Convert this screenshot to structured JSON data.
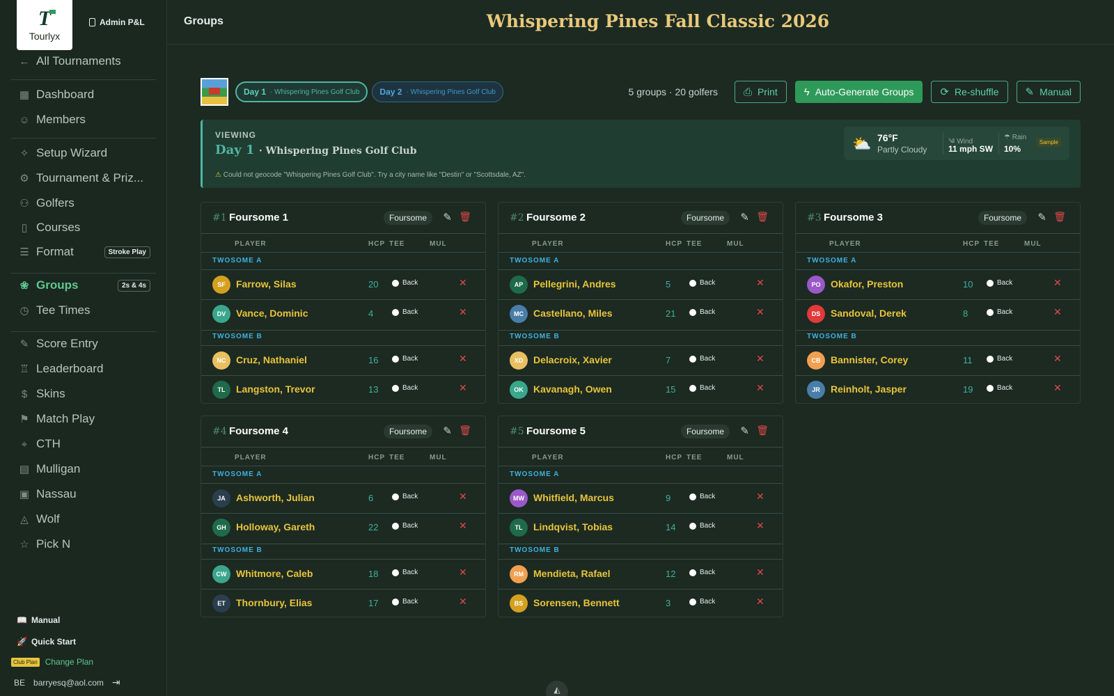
{
  "brand": {
    "logo_text": "Tourlyx",
    "admin_label": "Admin P&L"
  },
  "sidebar": {
    "back": "All Tournaments",
    "items": [
      {
        "label": "Dashboard",
        "icon": "grid-icon"
      },
      {
        "label": "Members",
        "icon": "user-icon"
      },
      {
        "label": "Setup Wizard",
        "icon": "sparkle-icon"
      },
      {
        "label": "Tournament & Priz...",
        "icon": "gear-icon"
      },
      {
        "label": "Golfers",
        "icon": "users-icon"
      },
      {
        "label": "Courses",
        "icon": "map-icon"
      },
      {
        "label": "Format",
        "icon": "sliders-icon",
        "badge": "Stroke Play"
      },
      {
        "label": "Groups",
        "icon": "group-icon",
        "badge": "2s & 4s",
        "active": true
      },
      {
        "label": "Tee Times",
        "icon": "clock-icon"
      },
      {
        "label": "Score Entry",
        "icon": "pencil-icon"
      },
      {
        "label": "Leaderboard",
        "icon": "trophy-icon"
      },
      {
        "label": "Skins",
        "icon": "dollar-icon"
      },
      {
        "label": "Match Play",
        "icon": "flag-icon"
      },
      {
        "label": "CTH",
        "icon": "pin-icon"
      },
      {
        "label": "Mulligan",
        "icon": "ticket-icon"
      },
      {
        "label": "Nassau",
        "icon": "money-icon"
      },
      {
        "label": "Wolf",
        "icon": "wolf-icon"
      },
      {
        "label": "Pick N",
        "icon": "star-icon"
      }
    ],
    "manual": "Manual",
    "quick_start": "Quick Start",
    "plan_badge": "Club Plan",
    "change_plan": "Change Plan",
    "user_initials": "BE",
    "user_email": "barryesq@aol.com"
  },
  "header": {
    "page": "Groups",
    "title": "Whispering Pines Fall Classic 2026"
  },
  "toolbar": {
    "days": [
      {
        "label": "Day 1",
        "course": "· Whispering Pines Golf Club"
      },
      {
        "label": "Day 2",
        "course": "· Whispering Pines Golf Club"
      }
    ],
    "stats": "5 groups · 20 golfers",
    "print": "Print",
    "auto": "Auto-Generate Groups",
    "reshuffle": "Re-shuffle",
    "manual": "Manual"
  },
  "viewing": {
    "label": "VIEWING",
    "day": "Day 1",
    "course": "· Whispering Pines Golf Club",
    "warning": "Could not geocode \"Whispering Pines Golf Club\". Try a city name like \"Destin\" or \"Scottsdale, AZ\".",
    "weather": {
      "temp": "76°F",
      "condition": "Partly Cloudy",
      "wind_label": "Wind",
      "wind": "11 mph SW",
      "rain_label": "Rain",
      "rain": "10%",
      "badge": "Sample"
    }
  },
  "columns": {
    "player": "PLAYER",
    "hcp": "HCP",
    "tee": "TEE",
    "mul": "MUL"
  },
  "twosome_a": "TWOSOME A",
  "twosome_b": "TWOSOME B",
  "groups": [
    {
      "num": "#1",
      "name": "Foursome 1",
      "type": "Foursome",
      "players": [
        {
          "initials": "SF",
          "name": "Farrow, Silas",
          "hcp": "20",
          "tee": "Back",
          "color": "#d4a020"
        },
        {
          "initials": "DV",
          "name": "Vance, Dominic",
          "hcp": "4",
          "tee": "Back",
          "color": "#3aa68c"
        },
        {
          "initials": "NC",
          "name": "Cruz, Nathaniel",
          "hcp": "16",
          "tee": "Back",
          "color": "#e8c060"
        },
        {
          "initials": "TL",
          "name": "Langston, Trevor",
          "hcp": "13",
          "tee": "Back",
          "color": "#1f6a4a"
        }
      ]
    },
    {
      "num": "#2",
      "name": "Foursome 2",
      "type": "Foursome",
      "players": [
        {
          "initials": "AP",
          "name": "Pellegrini, Andres",
          "hcp": "5",
          "tee": "Back",
          "color": "#1f6a4a"
        },
        {
          "initials": "MC",
          "name": "Castellano, Miles",
          "hcp": "21",
          "tee": "Back",
          "color": "#4a7ea8"
        },
        {
          "initials": "XD",
          "name": "Delacroix, Xavier",
          "hcp": "7",
          "tee": "Back",
          "color": "#e8c060"
        },
        {
          "initials": "OK",
          "name": "Kavanagh, Owen",
          "hcp": "15",
          "tee": "Back",
          "color": "#3aa68c"
        }
      ]
    },
    {
      "num": "#3",
      "name": "Foursome 3",
      "type": "Foursome",
      "players": [
        {
          "initials": "PO",
          "name": "Okafor, Preston",
          "hcp": "10",
          "tee": "Back",
          "color": "#9a58c8"
        },
        {
          "initials": "DS",
          "name": "Sandoval, Derek",
          "hcp": "8",
          "tee": "Back",
          "color": "#e03a3a"
        },
        {
          "initials": "CB",
          "name": "Bannister, Corey",
          "hcp": "11",
          "tee": "Back",
          "color": "#f0a050"
        },
        {
          "initials": "JR",
          "name": "Reinholt, Jasper",
          "hcp": "19",
          "tee": "Back",
          "color": "#4a7ea8"
        }
      ]
    },
    {
      "num": "#4",
      "name": "Foursome 4",
      "type": "Foursome",
      "players": [
        {
          "initials": "JA",
          "name": "Ashworth, Julian",
          "hcp": "6",
          "tee": "Back",
          "color": "#2a3e4e"
        },
        {
          "initials": "GH",
          "name": "Holloway, Gareth",
          "hcp": "22",
          "tee": "Back",
          "color": "#1f6a4a"
        },
        {
          "initials": "CW",
          "name": "Whitmore, Caleb",
          "hcp": "18",
          "tee": "Back",
          "color": "#3aa68c"
        },
        {
          "initials": "ET",
          "name": "Thornbury, Elias",
          "hcp": "17",
          "tee": "Back",
          "color": "#2a3e4e"
        }
      ]
    },
    {
      "num": "#5",
      "name": "Foursome 5",
      "type": "Foursome",
      "players": [
        {
          "initials": "MW",
          "name": "Whitfield, Marcus",
          "hcp": "9",
          "tee": "Back",
          "color": "#9a58c8"
        },
        {
          "initials": "TL",
          "name": "Lindqvist, Tobias",
          "hcp": "14",
          "tee": "Back",
          "color": "#1f6a4a"
        },
        {
          "initials": "RM",
          "name": "Mendieta, Rafael",
          "hcp": "12",
          "tee": "Back",
          "color": "#f0a050"
        },
        {
          "initials": "BS",
          "name": "Sorensen, Bennett",
          "hcp": "3",
          "tee": "Back",
          "color": "#d4a020"
        }
      ]
    }
  ]
}
